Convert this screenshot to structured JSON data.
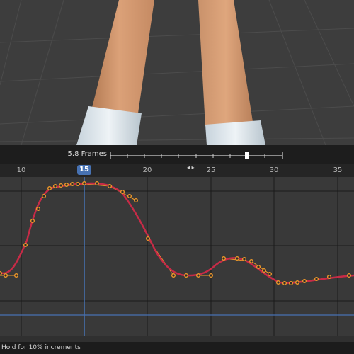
{
  "slider": {
    "label": "5.8 Frames"
  },
  "timeline": {
    "ticks": [
      "10",
      "15",
      "20",
      "25",
      "30",
      "35"
    ],
    "current_frame": "15"
  },
  "status": {
    "hint": "Hold for 10% increments"
  },
  "colors": {
    "curve": "#c72b47",
    "keyframe": "#f19a2a",
    "playhead": "#4772b3",
    "grid_line": "#1b1b1b"
  }
}
